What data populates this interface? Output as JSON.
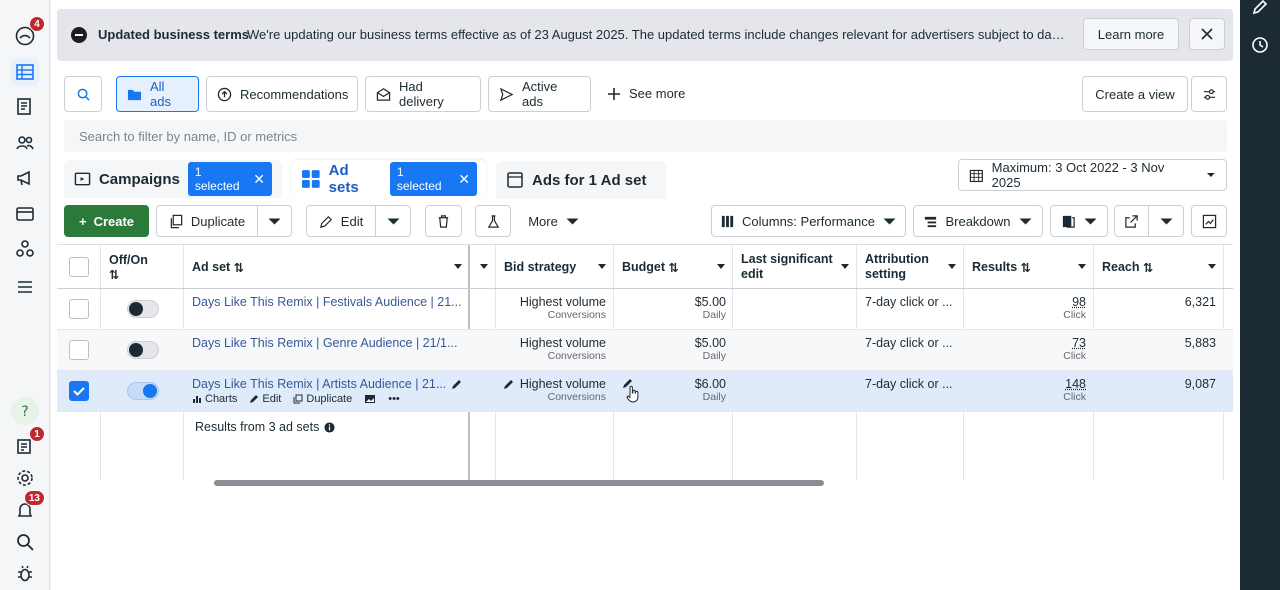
{
  "leftnav": {
    "badges": {
      "account": "4",
      "notifications_center": "1",
      "alerts": "13"
    }
  },
  "banner": {
    "title": "Updated business terms",
    "text": "We're updating our business terms effective as of 23 August 2025. The updated terms include changes relevant for advertisers subject to data ...",
    "learn_more": "Learn more"
  },
  "filters": {
    "all_ads": "All ads",
    "recommendations": "Recommendations",
    "had_delivery": "Had delivery",
    "active_ads": "Active ads",
    "see_more": "See more",
    "create_view": "Create a view"
  },
  "search": {
    "placeholder": "Search to filter by name, ID or metrics"
  },
  "level_tabs": {
    "campaigns": "Campaigns",
    "campaigns_chip": "1 selected",
    "adsets": "Ad sets",
    "adsets_chip": "1 selected",
    "ads": "Ads for 1 Ad set"
  },
  "date_range": "Maximum: 3 Oct 2022 - 3 Nov 2025",
  "toolbar": {
    "create": "Create",
    "duplicate": "Duplicate",
    "edit": "Edit",
    "more": "More",
    "columns": "Columns: Performance",
    "breakdown": "Breakdown"
  },
  "table": {
    "headers": {
      "offon": "Off/On",
      "adset": "Ad set",
      "bid_strategy": "Bid strategy",
      "budget": "Budget",
      "last_edit": "Last significant edit",
      "attribution": "Attribution setting",
      "results": "Results",
      "reach": "Reach"
    },
    "rows": [
      {
        "name": "Days Like This Remix | Festivals Audience | 21...",
        "bid": "Highest volume",
        "bid_sub": "Conversions",
        "budget": "$5.00",
        "budget_sub": "Daily",
        "attribution": "7-day click or ...",
        "results": "98",
        "results_sub": "Click",
        "reach": "6,321"
      },
      {
        "name": "Days Like This Remix | Genre Audience | 21/1...",
        "bid": "Highest volume",
        "bid_sub": "Conversions",
        "budget": "$5.00",
        "budget_sub": "Daily",
        "attribution": "7-day click or ...",
        "results": "73",
        "results_sub": "Click",
        "reach": "5,883"
      },
      {
        "name": "Days Like This Remix | Artists Audience | 21...",
        "bid": "Highest volume",
        "bid_sub": "Conversions",
        "budget": "$6.00",
        "budget_sub": "Daily",
        "attribution": "7-day click or ...",
        "results": "148",
        "results_sub": "Click",
        "reach": "9,087"
      }
    ],
    "row_actions": {
      "charts": "Charts",
      "edit": "Edit",
      "duplicate": "Duplicate"
    },
    "summary": "Results from 3 ad sets"
  },
  "colors": {
    "accent": "#1877f2",
    "create_green": "#2c7a3a",
    "selected_row": "#dfeafa"
  }
}
